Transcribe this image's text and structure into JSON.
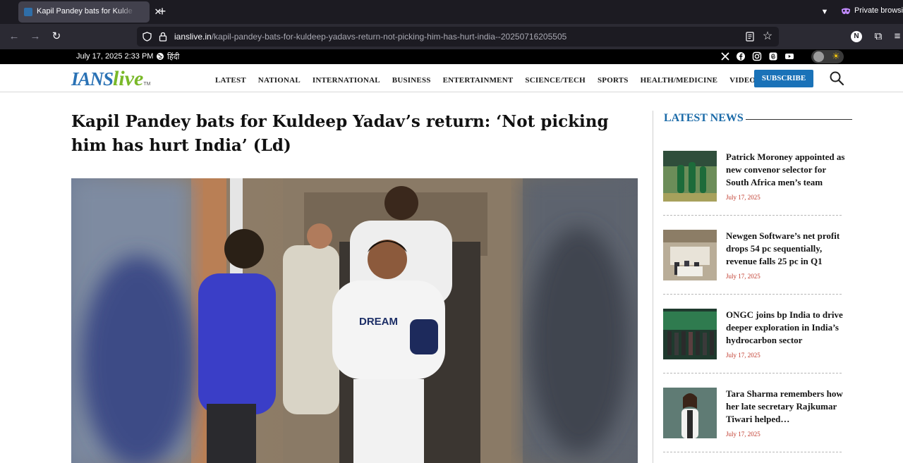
{
  "browser": {
    "tab_title": "Kapil Pandey bats for Kuldeep Yadav's return",
    "private_label": "Private browsing",
    "url_host": "ianslive.in",
    "url_path": "/kapil-pandey-bats-for-kuldeep-yadavs-return-not-picking-him-has-hurt-india--20250716205505",
    "ext_letter": "N"
  },
  "topstrip": {
    "datetime": "July 17, 2025 2:33 PM",
    "language": "हिंदी"
  },
  "header": {
    "logo_main": "IANS",
    "logo_accent": "live",
    "logo_tm": "TM",
    "nav": [
      "LATEST",
      "NATIONAL",
      "INTERNATIONAL",
      "BUSINESS",
      "ENTERTAINMENT",
      "SCIENCE/TECH",
      "SPORTS",
      "HEALTH/MEDICINE",
      "VIDEO"
    ],
    "subscribe_label": "SUBSCRIBE"
  },
  "article": {
    "headline": "Kapil Pandey bats for Kuldeep Yadav’s return: ‘Not picking him has hurt India’ (Ld)",
    "jersey_text": "DREAM"
  },
  "sidebar": {
    "title": "LATEST NEWS",
    "items": [
      {
        "title": "Patrick Moroney appointed as new convenor selector for South Africa men’s team",
        "date": "July 17, 2025"
      },
      {
        "title": "Newgen Software’s net profit drops 54 pc sequentially, revenue falls 25 pc in Q1",
        "date": "July 17, 2025"
      },
      {
        "title": "ONGC joins bp India to drive deeper exploration in India’s hydrocarbon sector",
        "date": "July 17, 2025"
      },
      {
        "title": "Tara Sharma remembers how her late secretary Rajkumar Tiwari helped…",
        "date": "July 17, 2025"
      }
    ]
  },
  "colors": {
    "brand_blue": "#1a72b8",
    "brand_green": "#7ab929",
    "date_red": "#c0392b"
  }
}
